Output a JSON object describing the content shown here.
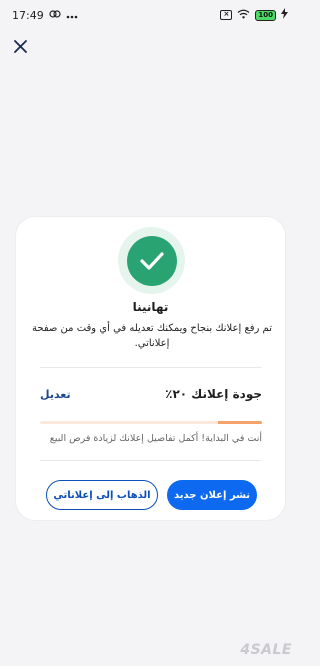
{
  "status_bar": {
    "time": "17:49",
    "battery_label": "100"
  },
  "dialog": {
    "title": "تهانينا",
    "message": "تم رفع إعلانك بنجاح ويمكنك تعديله في أي وقت من صفحة إعلاناتي.",
    "quality_label": "جودة إعلانك ٢٠٪",
    "quality_progress_percent": 20,
    "edit_label": "تعديل",
    "hint": "أنت في البداية! أكمل تفاصيل إعلانك لزيادة فرص البيع",
    "post_new_label": "نشر إعلان جديد",
    "go_to_my_ads_label": "الذهاب إلى إعلاناتي"
  },
  "watermark": "4SALE",
  "colors": {
    "primary": "#0d6af0",
    "success": "#2aa372",
    "progress": "#f6a26a"
  }
}
